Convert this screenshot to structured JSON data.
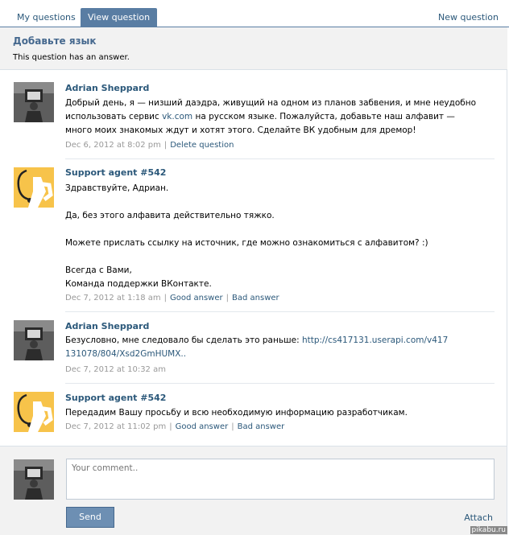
{
  "tabs": {
    "my_questions": "My questions",
    "view_question": "View question",
    "new_question": "New question"
  },
  "header": {
    "title": "Добавьте язык",
    "subtitle": "This question has an answer."
  },
  "messages": [
    {
      "author": "Adrian Sheppard",
      "body_before": "Добрый день, я — низший даэдра, живущий на одном из планов забвения, и мне неудобно использовать сервис ",
      "body_link": "vk.com",
      "body_after": " на русском языке. Пожалуйста, добавьте наш алфавит — много моих знакомых ждут и хотят этого. Сделайте ВК удобным для дремор!",
      "date": "Dec 6, 2012 at 8:02 pm",
      "action": "Delete question"
    },
    {
      "author": "Support agent #542",
      "lines": [
        "Здравствуйте, Адриан.",
        "Да, без этого алфавита действительно тяжко.",
        "Можете прислать ссылку на источник, где можно ознакомиться с алфавитом? :)",
        "Всегда с Вами,",
        "Команда поддержки ВКонтакте."
      ],
      "date": "Dec 7, 2012 at 1:18 am",
      "good": "Good answer",
      "bad": "Bad answer"
    },
    {
      "author": "Adrian Sheppard",
      "body_before": "Безусловно, мне следовало бы сделать это раньше: ",
      "body_link": "http://cs417131.userapi.com/v417131078/804/Xsd2GmHUMX..",
      "date": "Dec 7, 2012 at 10:32 am"
    },
    {
      "author": "Support agent #542",
      "body": "Передадим Вашу просьбу и всю необходимую информацию разработчикам.",
      "date": "Dec 7, 2012 at 11:02 pm",
      "good": "Good answer",
      "bad": "Bad answer"
    }
  ],
  "compose": {
    "placeholder": "Your comment..",
    "send": "Send",
    "attach": "Attach"
  },
  "watermark": "pikabu.ru",
  "colors": {
    "accent": "#597da3",
    "link": "#2b587a",
    "agent_avatar": "#f7c34a"
  }
}
